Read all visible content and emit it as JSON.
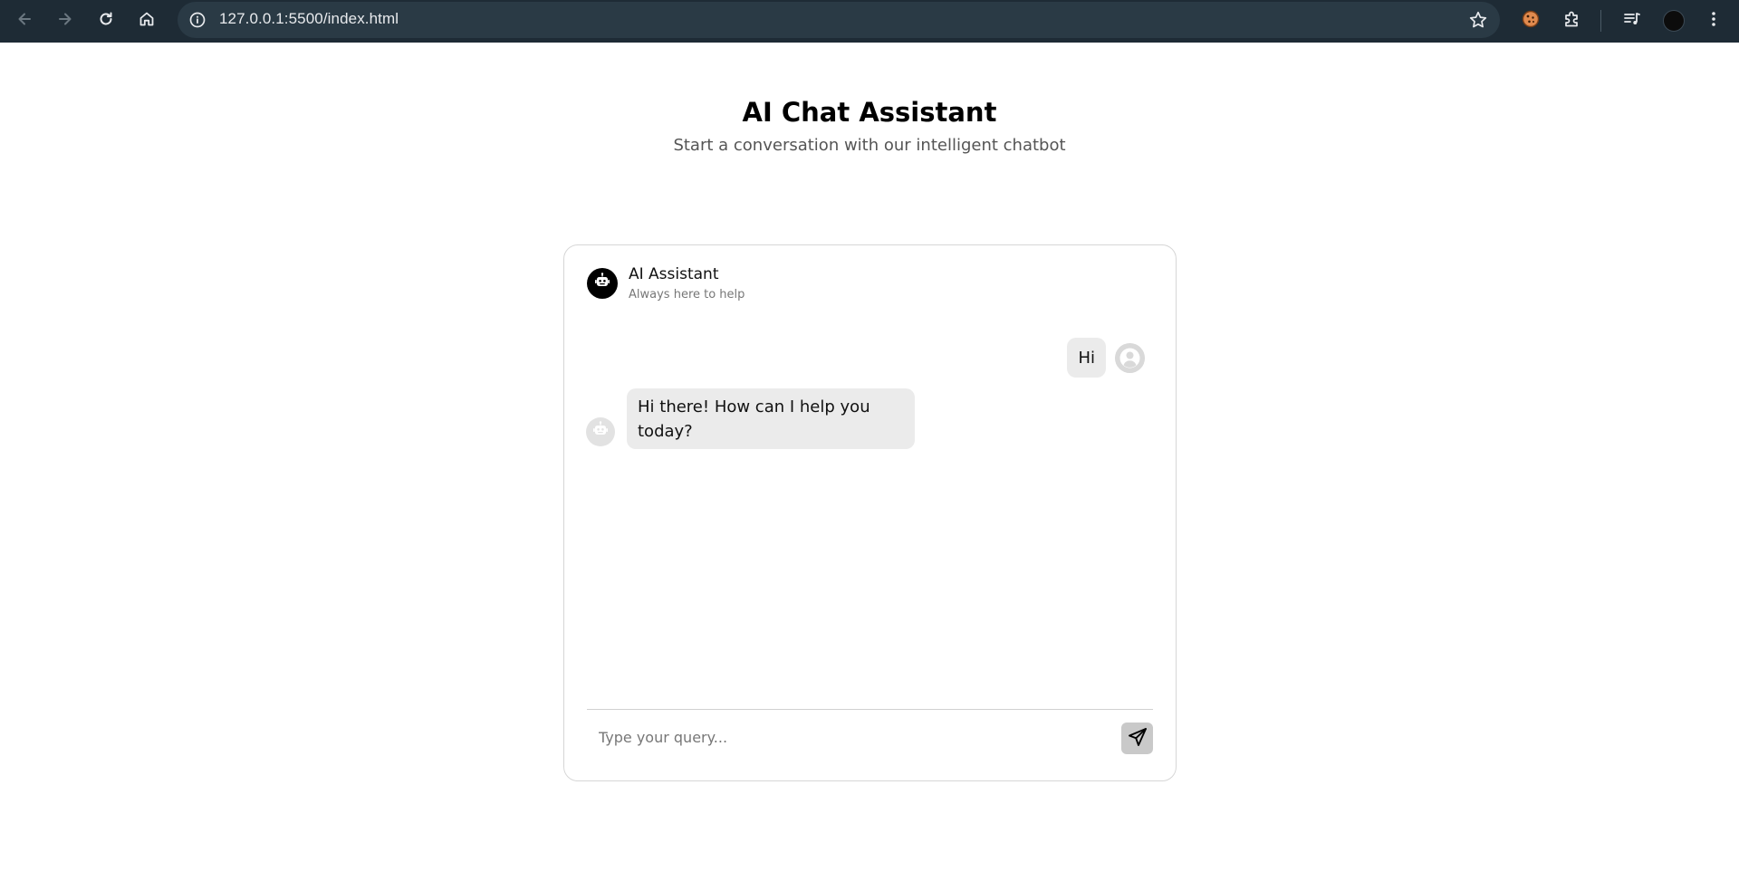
{
  "browser": {
    "url": "127.0.0.1:5500/index.html",
    "icons": {
      "back": "arrow-left-icon",
      "forward": "arrow-right-icon",
      "reload": "reload-icon",
      "home": "home-icon",
      "site_info": "info-icon",
      "bookmark": "star-icon",
      "extension_cookie": "cookie-icon",
      "extensions": "puzzle-icon",
      "media": "media-queue-icon",
      "menu": "kebab-menu-icon"
    }
  },
  "page": {
    "title": "AI Chat Assistant",
    "subtitle": "Start a conversation with our intelligent chatbot"
  },
  "chat": {
    "header": {
      "name": "AI Assistant",
      "status": "Always here to help",
      "avatar_icon": "robot-icon"
    },
    "messages": [
      {
        "role": "user",
        "text": "Hi",
        "avatar_icon": "user-icon"
      },
      {
        "role": "bot",
        "text": "Hi there! How can I help you today?",
        "avatar_icon": "robot-icon"
      }
    ],
    "input": {
      "placeholder": "Type your query...",
      "value": "",
      "send_icon": "send-icon"
    }
  },
  "colors": {
    "chrome_bg": "#1e2b35",
    "omnibox_bg": "#2a3a45",
    "bubble_bg": "#ebebeb",
    "send_button_bg": "#c9c9c9",
    "card_border": "#d6d6d6"
  }
}
